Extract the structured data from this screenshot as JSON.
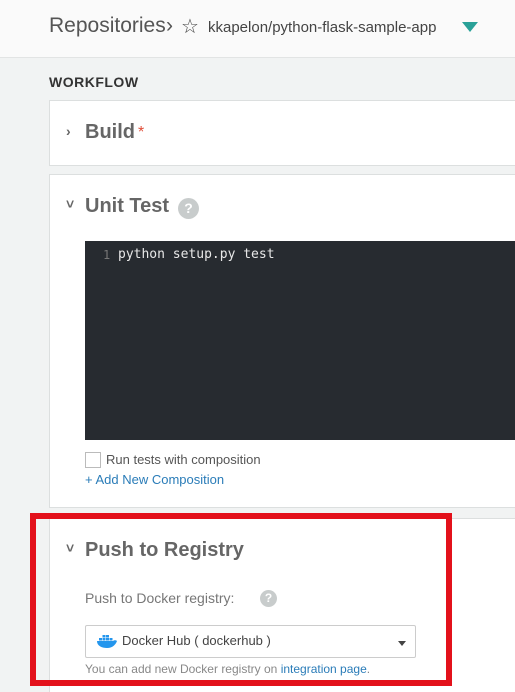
{
  "header": {
    "breadcrumb": "Repositories",
    "separator": "›",
    "star_icon": "☆",
    "repo_name": "kkapelon/python-flask-sample-app",
    "dropdown_color": "#2aa198"
  },
  "workflow": {
    "label": "WORKFLOW",
    "build": {
      "title": "Build",
      "required_mark": "*",
      "chevron": "›"
    },
    "unit_test": {
      "title": "Unit Test",
      "help": "?",
      "chevron": "˅",
      "editor": {
        "line_number": "1",
        "code": "python setup.py test"
      },
      "checkbox_label": "Run tests with composition",
      "add_composition": "+ Add New Composition"
    },
    "push": {
      "title": "Push to Registry",
      "chevron": "˅",
      "subtitle": "Push to Docker registry:",
      "help": "?",
      "select_value": "Docker Hub ( dockerhub )",
      "hint_prefix": "You can add new Docker registry on",
      "hint_link": "integration page",
      "hint_suffix": "."
    }
  },
  "colors": {
    "highlight": "#e3111b",
    "link": "#2a7cb8",
    "editor_bg": "#272b30"
  }
}
